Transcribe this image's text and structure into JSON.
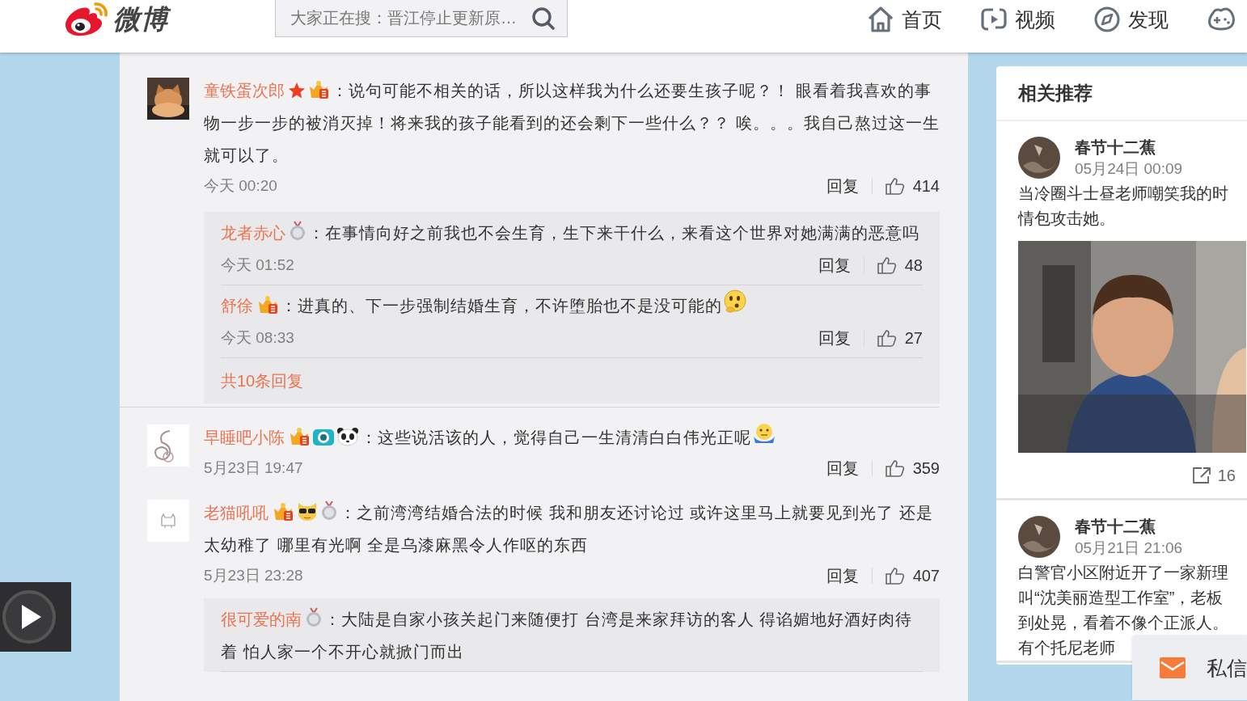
{
  "header": {
    "logo_text": "微博",
    "search": {
      "placeholder": "大家正在搜：晋江停止更新原…"
    },
    "nav": [
      {
        "kind": "home",
        "label": "首页"
      },
      {
        "kind": "video",
        "label": "视频"
      },
      {
        "kind": "discover",
        "label": "发现"
      },
      {
        "kind": "game"
      }
    ]
  },
  "comments": [
    {
      "user": "童铁蛋次郎",
      "badges": [
        {
          "kind": "star"
        },
        {
          "kind": "crown"
        }
      ],
      "text": "：说句可能不相关的话，所以这样我为什么还要生孩子呢？！ 眼看着我喜欢的事物一步一步的被消灭掉！将来我的孩子能看到的还会剩下一些什么？？ 唉。。。我自己熬过这一生就可以了。",
      "time": "今天 00:20",
      "reply_label": "回复",
      "likes": "414",
      "replies": [
        {
          "user": "龙者赤心",
          "badges": [
            {
              "kind": "medal"
            }
          ],
          "text": "：在事情向好之前我也不会生育，生下来干什么，来看这个世界对她满满的恶意吗",
          "time": "今天 01:52",
          "reply_label": "回复",
          "likes": "48"
        },
        {
          "user": "舒徐",
          "badges": [
            {
              "kind": "crown"
            }
          ],
          "text": "：进真的、下一步强制结婚生育，不许堕胎也不是没可能的",
          "emoji": {
            "kind": "thinking"
          },
          "time": "今天 08:33",
          "reply_label": "回复",
          "likes": "27"
        }
      ],
      "more_link": "共10条回复"
    },
    {
      "user": "早睡吧小陈",
      "badges": [
        {
          "kind": "crown"
        },
        {
          "kind": "camera"
        },
        {
          "kind": "panda"
        }
      ],
      "text": "：这些说活该的人，觉得自己一生清清白白伟光正呢",
      "emoji": {
        "kind": "shrug"
      },
      "time": "5月23日 19:47",
      "reply_label": "回复",
      "likes": "359"
    },
    {
      "user": "老猫吼吼",
      "badges": [
        {
          "kind": "crown"
        },
        {
          "kind": "sunglasses"
        },
        {
          "kind": "medal"
        }
      ],
      "text": "：之前湾湾结婚合法的时候 我和朋友还讨论过 或许这里马上就要见到光了 还是太幼稚了 哪里有光啊 全是乌漆麻黑令人作呕的东西",
      "time": "5月23日 23:28",
      "reply_label": "回复",
      "likes": "407",
      "replies": [
        {
          "user": "很可爱的南",
          "badges": [
            {
              "kind": "medal"
            }
          ],
          "text": "：大陆是自家小孩关起门来随便打 台湾是来家拜访的客人 得谄媚地好酒好肉待着 怕人家一个不开心就掀门而出"
        }
      ]
    }
  ],
  "sidebar": {
    "title": "相关推荐",
    "posts": [
      {
        "author": "春节十二蕉",
        "date": "05月24日 00:09",
        "lines": [
          "当冷圈斗士昼老师嘲笑我的时",
          "情包攻击她。"
        ],
        "media": {
          "kind": "picture"
        },
        "shares": "16"
      },
      {
        "author": "春节十二蕉",
        "date": "05月21日 21:06",
        "lines": [
          "白警官小区附近开了一家新理",
          "叫“沈美丽造型工作室”，老板",
          "到处晃，看着不像个正派人。",
          "有个托尼老师"
        ]
      }
    ]
  },
  "messages": {
    "label": "私信"
  }
}
